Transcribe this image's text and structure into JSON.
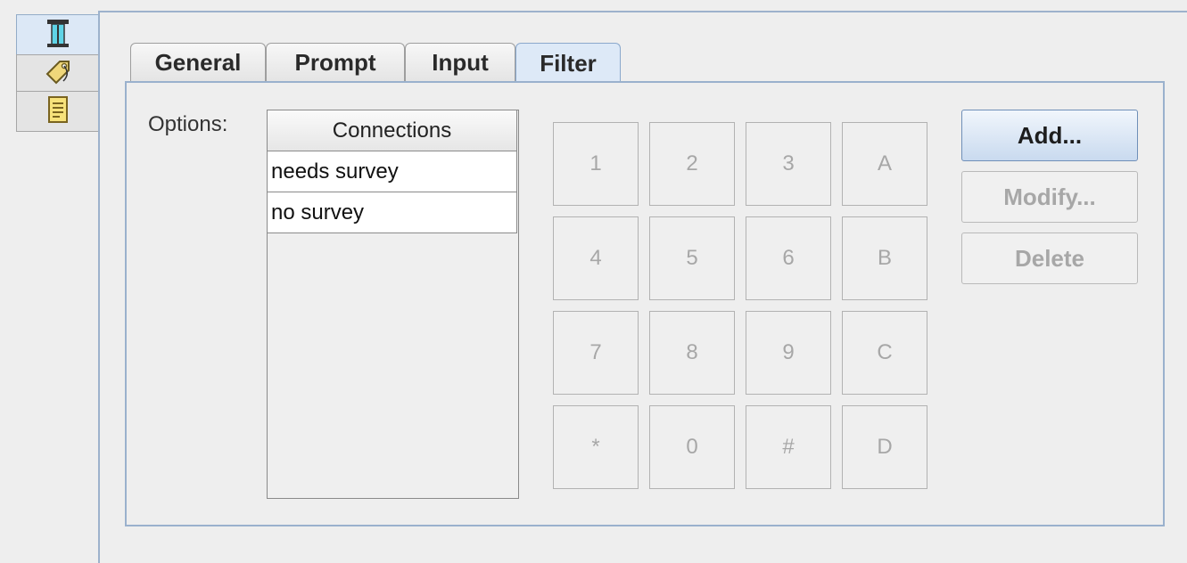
{
  "side_tabs": [
    {
      "icon": "properties-icon",
      "active": true
    },
    {
      "icon": "tag-icon",
      "active": false
    },
    {
      "icon": "document-icon",
      "active": false
    }
  ],
  "tabs": [
    {
      "label": "General",
      "active": false
    },
    {
      "label": "Prompt",
      "active": false
    },
    {
      "label": "Input",
      "active": false
    },
    {
      "label": "Filter",
      "active": true
    }
  ],
  "options": {
    "label": "Options:",
    "column_header": "Connections",
    "rows": [
      "needs survey",
      "no survey"
    ]
  },
  "keypad": [
    "1",
    "2",
    "3",
    "A",
    "4",
    "5",
    "6",
    "B",
    "7",
    "8",
    "9",
    "C",
    "*",
    "0",
    "#",
    "D"
  ],
  "buttons": {
    "add": "Add...",
    "modify": "Modify...",
    "delete": "Delete"
  },
  "colors": {
    "accent": "#9ab1cd",
    "disabled_text": "#a7a7a7"
  }
}
